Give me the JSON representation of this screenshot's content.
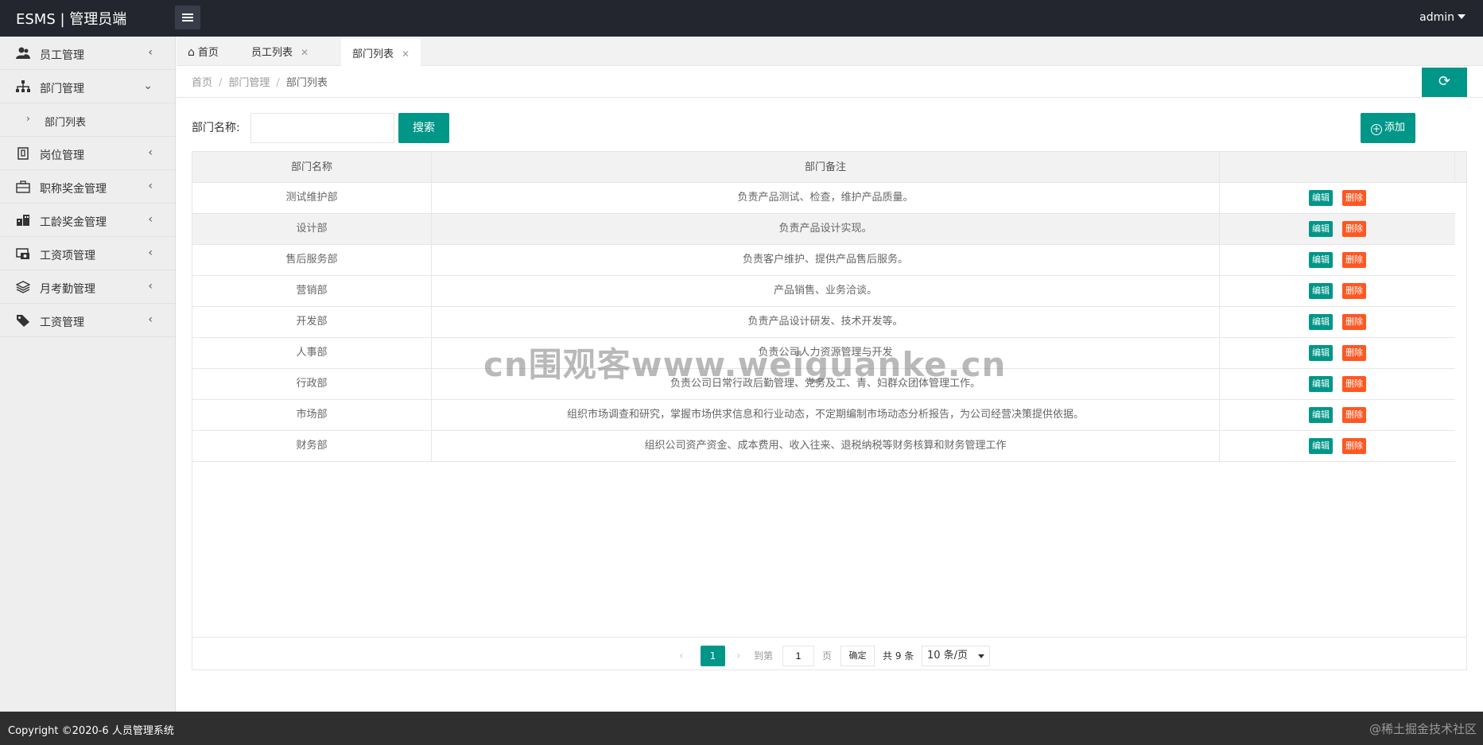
{
  "header": {
    "title": "ESMS | 管理员端",
    "user": "admin"
  },
  "sidebar": {
    "items": [
      {
        "label": "员工管理",
        "icon": "user-group-icon",
        "arrow": "‹"
      },
      {
        "label": "部门管理",
        "icon": "sitemap-icon",
        "arrow": "⌄"
      },
      {
        "label": "岗位管理",
        "icon": "id-badge-icon",
        "arrow": "‹"
      },
      {
        "label": "职称奖金管理",
        "icon": "briefcase-icon",
        "arrow": "‹"
      },
      {
        "label": "工龄奖金管理",
        "icon": "building-icon",
        "arrow": "‹"
      },
      {
        "label": "工资项管理",
        "icon": "money-icon",
        "arrow": "‹"
      },
      {
        "label": "月考勤管理",
        "icon": "layers-icon",
        "arrow": "‹"
      },
      {
        "label": "工资管理",
        "icon": "tag-icon",
        "arrow": "‹"
      }
    ],
    "sub": {
      "label": "部门列表",
      "arrow": "›"
    }
  },
  "tabs": [
    {
      "label": "首页"
    },
    {
      "label": "员工列表"
    },
    {
      "label": "部门列表"
    }
  ],
  "breadcrumb": {
    "home": "首页",
    "mid": "部门管理",
    "current": "部门列表",
    "sep": "/"
  },
  "search": {
    "label": "部门名称:",
    "value": "",
    "button": "搜索"
  },
  "add_button": "添加",
  "table": {
    "headers": [
      "部门名称",
      "部门备注",
      ""
    ],
    "edit_label": "编辑",
    "delete_label": "删除",
    "rows": [
      {
        "name": "测试维护部",
        "note": "负责产品测试、检查，维护产品质量。"
      },
      {
        "name": "设计部",
        "note": "负责产品设计实现。"
      },
      {
        "name": "售后服务部",
        "note": "负责客户维护、提供产品售后服务。"
      },
      {
        "name": "营销部",
        "note": "产品销售、业务洽谈。"
      },
      {
        "name": "开发部",
        "note": "负责产品设计研发、技术开发等。"
      },
      {
        "name": "人事部",
        "note": "负责公司人力资源管理与开发"
      },
      {
        "name": "行政部",
        "note": "负责公司日常行政后勤管理、党务及工、青、妇群众团体管理工作。"
      },
      {
        "name": "市场部",
        "note": "组织市场调查和研究，掌握市场供求信息和行业动态，不定期编制市场动态分析报告，为公司经营决策提供依据。"
      },
      {
        "name": "财务部",
        "note": "组织公司资产资金、成本费用、收入往来、退税纳税等财务核算和财务管理工作"
      }
    ]
  },
  "pager": {
    "current": "1",
    "goto_label": "到第",
    "goto_value": "1",
    "page_label": "页",
    "ok_label": "确定",
    "total": "共 9 条",
    "page_size": "10 条/页"
  },
  "watermark": "cn围观客www.weiguanke.cn",
  "footer": {
    "copyright": "Copyright ©2020-6 人员管理系统",
    "brand": "@稀土掘金技术社区"
  },
  "colors": {
    "accent": "#009688",
    "danger": "#ff5722",
    "header_bg": "#23262e",
    "sidebar_bg": "#eeeeee"
  }
}
